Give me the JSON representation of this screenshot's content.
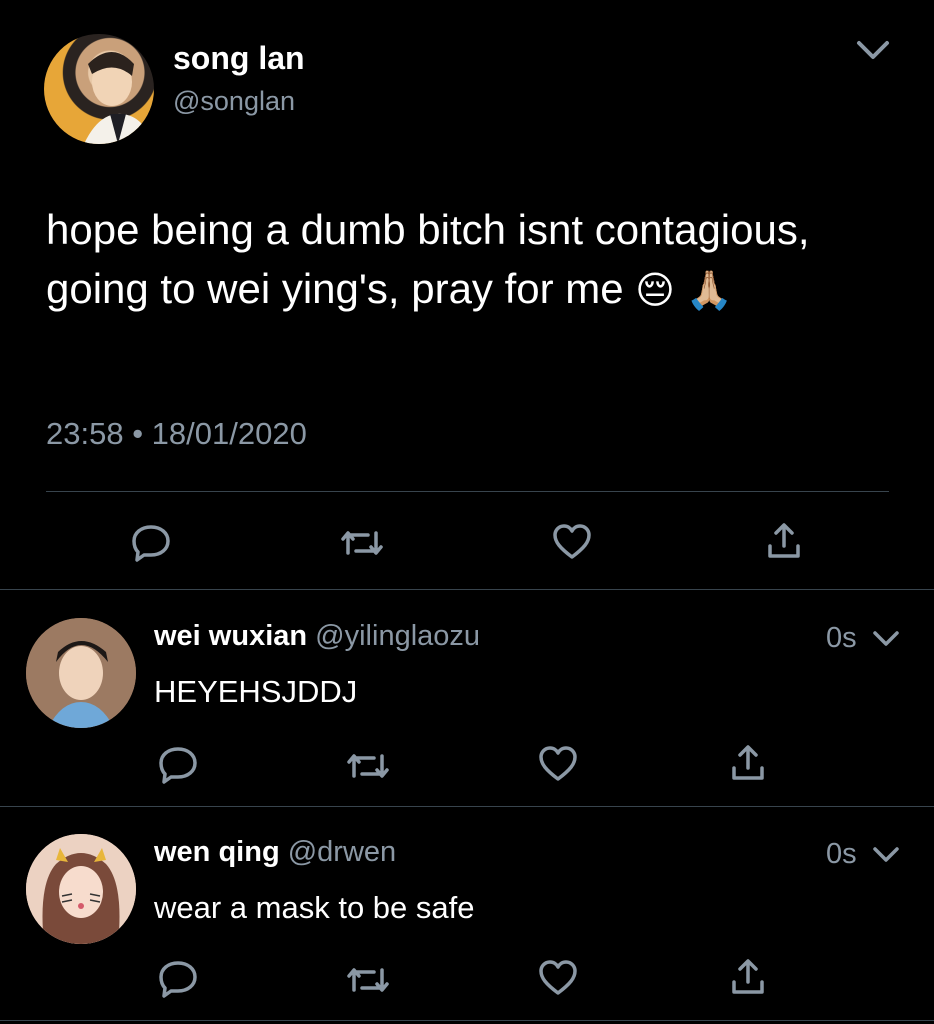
{
  "main_tweet": {
    "display_name": "song lan",
    "handle": "@songlan",
    "text": "hope being a dumb bitch isnt contagious, going to wei ying's, pray for me",
    "emoji": "😔 🙏🏼",
    "timestamp": "23:58 • 18/01/2020",
    "avatar_icon": "avatar-photo"
  },
  "replies": [
    {
      "display_name": "wei wuxian",
      "handle": "@yilinglaozu",
      "time": "0s",
      "text": "HEYEHSJDDJ",
      "avatar_icon": "avatar-photo"
    },
    {
      "display_name": "wen qing",
      "handle": "@drwen",
      "time": "0s",
      "text": "wear a mask to be safe",
      "avatar_icon": "avatar-photo"
    }
  ],
  "colors": {
    "background": "#000000",
    "text": "#ffffff",
    "muted": "#8b98a5",
    "divider": "#38444d"
  }
}
